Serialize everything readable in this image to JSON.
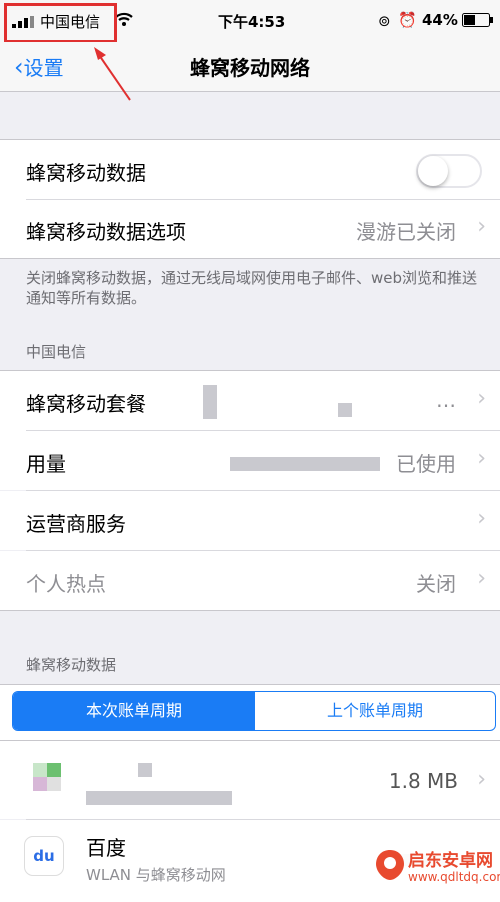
{
  "status": {
    "carrier": "中国电信",
    "time": "下午4:53",
    "battery": "44%",
    "battery_level": 0.44
  },
  "nav": {
    "back_label": "设置",
    "title": "蜂窝移动网络"
  },
  "cellular": {
    "data_label": "蜂窝移动数据",
    "data_on": false,
    "options_label": "蜂窝移动数据选项",
    "options_value": "漫游已关闭"
  },
  "footer_text": "关闭蜂窝移动数据，通过无线局域网使用电子邮件、web浏览和推送通知等所有数据。",
  "carrier_section": {
    "header": "中国电信",
    "plan_label": "蜂窝移动套餐",
    "plan_value": "…",
    "usage_label": "用量",
    "usage_value": "已使用",
    "carrier_services": "运营商服务",
    "hotspot_label": "个人热点",
    "hotspot_value": "关闭"
  },
  "data_section": {
    "header": "蜂窝移动数据",
    "tab_current": "本次账单周期",
    "tab_previous": "上个账单周期",
    "apps": [
      {
        "name": "",
        "sub": "",
        "size": "1.8 MB"
      },
      {
        "name": "百度",
        "sub": "WLAN 与蜂窝移动网",
        "size": ""
      }
    ]
  },
  "watermark": {
    "brand": "启东安卓网",
    "url": "www.qdltdq.com"
  },
  "colors": {
    "accent": "#1a7cf5",
    "highlight": "#e03030"
  }
}
